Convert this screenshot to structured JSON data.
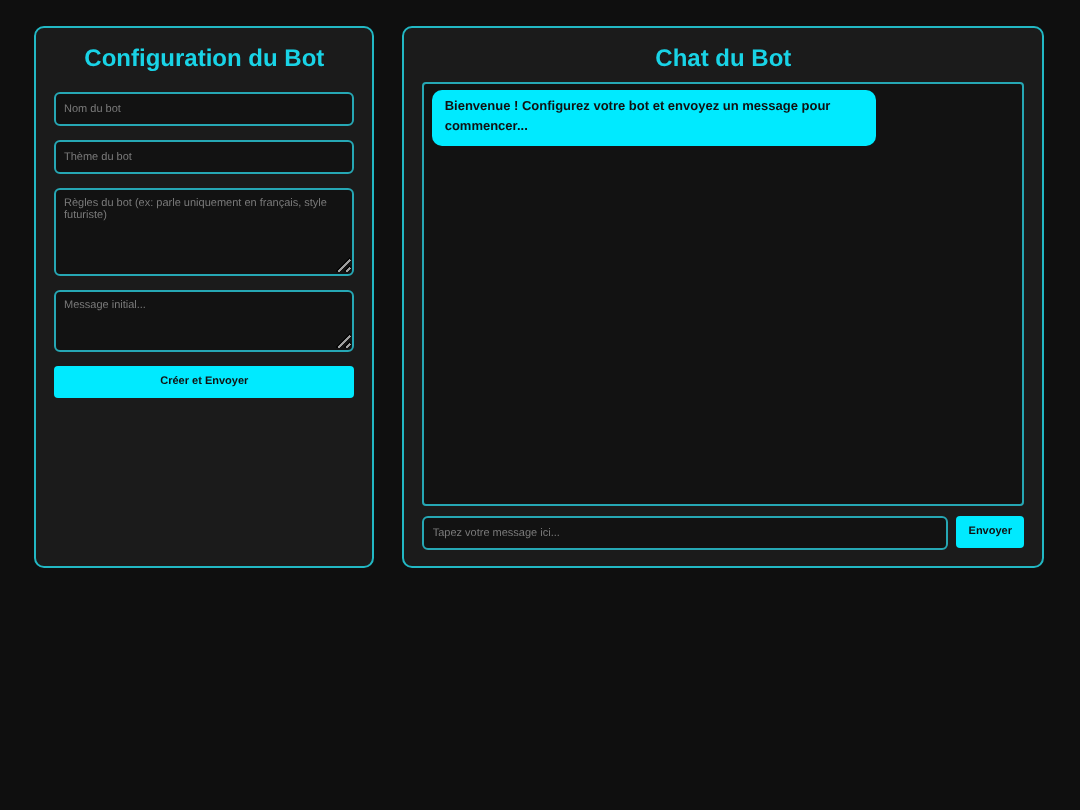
{
  "config": {
    "title": "Configuration du Bot",
    "fields": [
      {
        "kind": "input",
        "placeholder": "Nom du bot"
      },
      {
        "kind": "input",
        "placeholder": "Thème du bot"
      },
      {
        "kind": "textarea",
        "placeholder": "Règles du bot (ex: parle uniquement en français, style futuriste)"
      },
      {
        "kind": "memo",
        "placeholder": "Message initial..."
      }
    ],
    "button": "Créer et Envoyer"
  },
  "chat": {
    "title": "Chat du Bot",
    "messages": [
      {
        "kind": "bot",
        "text": "Bienvenue ! Configurez votre bot et envoyez un message pour commencer..."
      }
    ],
    "input": {
      "placeholder": "Tapez votre message ici..."
    },
    "button": "Envoyer"
  }
}
